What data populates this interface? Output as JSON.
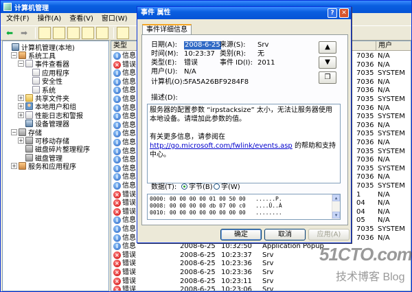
{
  "window": {
    "title": "计算机管理"
  },
  "menu": [
    "文件(F)",
    "操作(A)",
    "查看(V)",
    "窗口(W)"
  ],
  "tree": [
    {
      "label": "计算机管理(本地)",
      "icon": "computer-icon",
      "exp": "",
      "indent": 0
    },
    {
      "label": "系统工具",
      "icon": "tools-icon",
      "exp": "−",
      "indent": 1
    },
    {
      "label": "事件查看器",
      "icon": "event-viewer-icon",
      "exp": "−",
      "indent": 2
    },
    {
      "label": "应用程序",
      "icon": "log-icon",
      "exp": "",
      "indent": 3
    },
    {
      "label": "安全性",
      "icon": "log-icon",
      "exp": "",
      "indent": 3
    },
    {
      "label": "系统",
      "icon": "log-icon",
      "exp": "",
      "indent": 3
    },
    {
      "label": "共享文件夹",
      "icon": "folder-icon",
      "exp": "+",
      "indent": 2
    },
    {
      "label": "本地用户和组",
      "icon": "users-icon",
      "exp": "+",
      "indent": 2
    },
    {
      "label": "性能日志和警报",
      "icon": "performance-icon",
      "exp": "+",
      "indent": 2
    },
    {
      "label": "设备管理器",
      "icon": "device-manager-icon",
      "exp": "",
      "indent": 2
    },
    {
      "label": "存储",
      "icon": "storage-icon",
      "exp": "−",
      "indent": 1
    },
    {
      "label": "可移动存储",
      "icon": "removable-storage-icon",
      "exp": "+",
      "indent": 2
    },
    {
      "label": "磁盘碎片整理程序",
      "icon": "defrag-icon",
      "exp": "",
      "indent": 2
    },
    {
      "label": "磁盘管理",
      "icon": "disk-icon",
      "exp": "",
      "indent": 2
    },
    {
      "label": "服务和应用程序",
      "icon": "services-icon",
      "exp": "+",
      "indent": 1
    }
  ],
  "list": {
    "headers": [
      "类型",
      "用户"
    ],
    "rows": [
      {
        "sev": "info",
        "type": "信息",
        "date": "",
        "time": "",
        "src": "",
        "id": "7036",
        "user": "N/A"
      },
      {
        "sev": "err",
        "type": "错误",
        "date": "",
        "time": "",
        "src": "",
        "id": "7036",
        "user": "N/A"
      },
      {
        "sev": "info",
        "type": "信息",
        "date": "",
        "time": "",
        "src": "",
        "id": "7035",
        "user": "SYSTEM"
      },
      {
        "sev": "info",
        "type": "信息",
        "date": "",
        "time": "",
        "src": "",
        "id": "7036",
        "user": "N/A"
      },
      {
        "sev": "info",
        "type": "信息",
        "date": "",
        "time": "",
        "src": "",
        "id": "7036",
        "user": "N/A"
      },
      {
        "sev": "info",
        "type": "信息",
        "date": "",
        "time": "",
        "src": "",
        "id": "7035",
        "user": "SYSTEM"
      },
      {
        "sev": "info",
        "type": "信息",
        "date": "",
        "time": "",
        "src": "",
        "id": "7036",
        "user": "N/A"
      },
      {
        "sev": "info",
        "type": "信息",
        "date": "",
        "time": "",
        "src": "",
        "id": "7035",
        "user": "SYSTEM"
      },
      {
        "sev": "info",
        "type": "信息",
        "date": "",
        "time": "",
        "src": "",
        "id": "7036",
        "user": "N/A"
      },
      {
        "sev": "info",
        "type": "信息",
        "date": "",
        "time": "",
        "src": "",
        "id": "7035",
        "user": "SYSTEM"
      },
      {
        "sev": "info",
        "type": "信息",
        "date": "",
        "time": "",
        "src": "",
        "id": "7036",
        "user": "N/A"
      },
      {
        "sev": "info",
        "type": "信息",
        "date": "",
        "time": "",
        "src": "",
        "id": "7035",
        "user": "SYSTEM"
      },
      {
        "sev": "info",
        "type": "信息",
        "date": "",
        "time": "",
        "src": "",
        "id": "7036",
        "user": "N/A"
      },
      {
        "sev": "info",
        "type": "信息",
        "date": "",
        "time": "",
        "src": "",
        "id": "7035",
        "user": "SYSTEM"
      },
      {
        "sev": "info",
        "type": "信息",
        "date": "",
        "time": "",
        "src": "",
        "id": "7036",
        "user": "N/A"
      },
      {
        "sev": "info",
        "type": "信息",
        "date": "",
        "time": "",
        "src": "",
        "id": "7035",
        "user": "SYSTEM"
      },
      {
        "sev": "err",
        "type": "错误",
        "date": "",
        "time": "",
        "src": "",
        "id": "1",
        "user": "N/A"
      },
      {
        "sev": "err",
        "type": "错误",
        "date": "",
        "time": "",
        "src": "",
        "id": "04",
        "user": "N/A"
      },
      {
        "sev": "err",
        "type": "错误",
        "date": "",
        "time": "",
        "src": "",
        "id": "04",
        "user": "N/A"
      },
      {
        "sev": "info",
        "type": "信息",
        "date": "",
        "time": "",
        "src": "",
        "id": "05",
        "user": "N/A"
      },
      {
        "sev": "info",
        "type": "信息",
        "date": "",
        "time": "",
        "src": "",
        "id": "7035",
        "user": "SYSTEM"
      },
      {
        "sev": "info",
        "type": "信息",
        "date": "",
        "time": "",
        "src": "",
        "id": "7036",
        "user": "N/A"
      },
      {
        "sev": "info",
        "type": "信息",
        "date": "2008-6-25",
        "time": "10:32:50",
        "src": "Application Popup",
        "id": "",
        "user": ""
      },
      {
        "sev": "err",
        "type": "错误",
        "date": "2008-6-25",
        "time": "10:23:37",
        "src": "Srv",
        "id": "",
        "user": ""
      },
      {
        "sev": "err",
        "type": "错误",
        "date": "2008-6-25",
        "time": "10:23:36",
        "src": "Srv",
        "id": "",
        "user": ""
      },
      {
        "sev": "err",
        "type": "错误",
        "date": "2008-6-25",
        "time": "10:23:36",
        "src": "Srv",
        "id": "",
        "user": ""
      },
      {
        "sev": "err",
        "type": "错误",
        "date": "2008-6-25",
        "time": "10:23:11",
        "src": "Srv",
        "id": "",
        "user": ""
      },
      {
        "sev": "err",
        "type": "错误",
        "date": "2008-6-25",
        "time": "10:23:06",
        "src": "Srv",
        "id": "",
        "user": ""
      }
    ]
  },
  "dialog": {
    "title": "事件 属性",
    "tab": "事件详细信息",
    "date_label": "日期(A):",
    "date_value": "2008-6-25",
    "source_label": "来源(S):",
    "source_value": "Srv",
    "time_label": "时间(M):",
    "time_value": "10:23:37",
    "category_label": "类别(R):",
    "category_value": "无",
    "type_label": "类型(E):",
    "type_value": "错误",
    "eventid_label": "事件 ID(I):",
    "eventid_value": "2011",
    "user_label": "用户(U):",
    "user_value": "N/A",
    "computer_label": "计算机(O):",
    "computer_value": "5FA5A26BF9284F8",
    "desc_label": "描述(D):",
    "desc_p1": "服务器的配置参数 “irpstacksize” 太小，无法让服务器使用本地设备。请增加此参数的值。",
    "desc_p2": "有关更多信息，请参阅在",
    "desc_link": "http://go.microsoft.com/fwlink/events.asp",
    "desc_p3": "的帮助和支持中心。",
    "data_label": "数据(T):",
    "bytes_label": "字节(B)",
    "words_label": "字(W)",
    "hex": [
      "0000: 00 00 00 00 01 00 50 00   ......P.",
      "0008: 00 00 00 00 db 07 00 c0   ....Û..À",
      "0010: 00 00 00 00 00 00 00 00   ........"
    ],
    "ok": "确定",
    "cancel": "取消",
    "apply": "应用(A)"
  },
  "watermark": {
    "big": "51CTO.com",
    "small": "技术博客 Blog"
  }
}
